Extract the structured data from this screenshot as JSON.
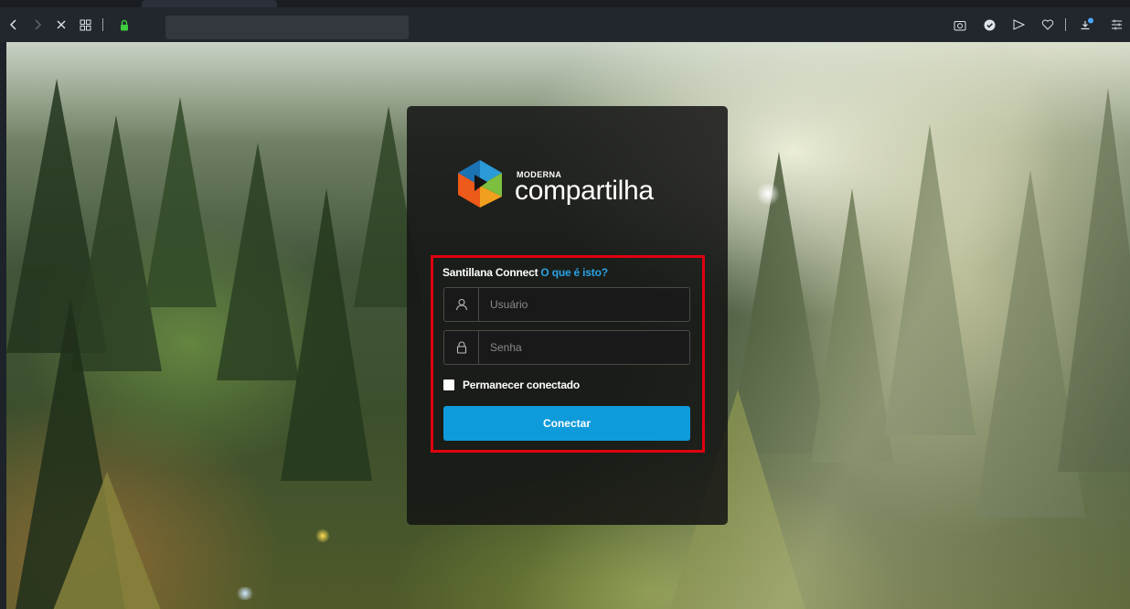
{
  "browser": {
    "icons": {
      "back": "chevron-left-icon",
      "forward": "chevron-right-icon",
      "close": "close-icon",
      "tabs_grid": "grid-icon",
      "lock": "lock-icon",
      "camera": "camera-icon",
      "shield": "shield-icon",
      "send": "send-icon",
      "heart": "heart-icon",
      "download": "download-icon",
      "settings": "settings-sliders-icon"
    },
    "address_value": ""
  },
  "login": {
    "logo": {
      "brand": "MODERNA",
      "product": "compartilha"
    },
    "connect_label": "Santillana Connect",
    "what_is_this_link": "O que é isto?",
    "username_placeholder": "Usuário",
    "password_placeholder": "Senha",
    "remember_label": "Permanecer conectado",
    "remember_checked": false,
    "submit_label": "Conectar"
  },
  "colors": {
    "accent": "#0e9bdb",
    "link": "#2aa3e6",
    "highlight": "#e0000f",
    "card": "#141414"
  }
}
